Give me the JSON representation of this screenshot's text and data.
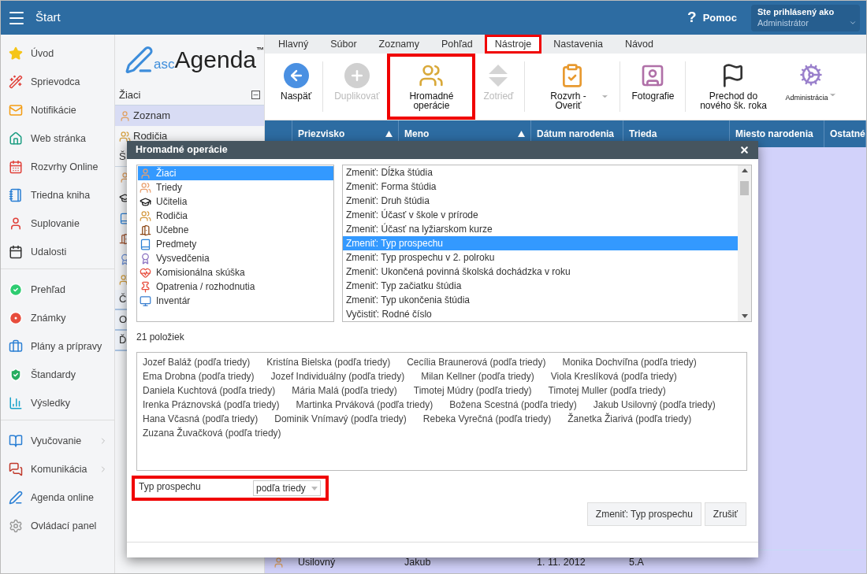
{
  "top_bar": {
    "title": "Štart",
    "help_mark": "?",
    "help_label": "Pomoc",
    "user": {
      "caption": "Ste prihlásený ako",
      "name": "Administrátor"
    }
  },
  "sidebar": {
    "groups": [
      {
        "items": [
          {
            "label": "Úvod",
            "expandable": false
          },
          {
            "label": "Sprievodca",
            "expandable": false
          },
          {
            "label": "Notifikácie",
            "expandable": false
          },
          {
            "label": "Web stránka",
            "expandable": false
          },
          {
            "label": "Rozvrhy Online",
            "expandable": false
          },
          {
            "label": "Triedna kniha",
            "expandable": false
          },
          {
            "label": "Suplovanie",
            "expandable": false
          },
          {
            "label": "Udalosti",
            "expandable": false
          }
        ]
      },
      {
        "items": [
          {
            "label": "Prehľad",
            "expandable": false
          },
          {
            "label": "Známky",
            "expandable": false
          },
          {
            "label": "Plány a prípravy",
            "expandable": false
          },
          {
            "label": "Štandardy",
            "expandable": false
          },
          {
            "label": "Výsledky",
            "expandable": false
          }
        ]
      },
      {
        "items": [
          {
            "label": "Vyučovanie",
            "expandable": true
          },
          {
            "label": "Komunikácia",
            "expandable": true
          },
          {
            "label": "Agenda online",
            "expandable": false
          },
          {
            "label": "Ovládací panel",
            "expandable": false
          }
        ]
      }
    ]
  },
  "logo": {
    "prefix": "asc",
    "name": "Agenda",
    "mark": "™"
  },
  "panel": {
    "sections": [
      {
        "title": "Žiaci",
        "expanded": true,
        "items": [
          {
            "label": "Zoznam",
            "selected": true
          },
          {
            "label": "Rodičia",
            "selected": false
          }
        ]
      },
      {
        "title": "Š",
        "expanded": true,
        "items": [
          {
            "selected": false
          },
          {
            "selected": false
          },
          {
            "selected": false
          },
          {
            "selected": false
          },
          {
            "selected": false
          },
          {
            "selected": false
          }
        ]
      },
      {
        "title": "Č",
        "expanded": false
      },
      {
        "title": "O",
        "expanded": false
      },
      {
        "title": "Ď",
        "expanded": false
      }
    ]
  },
  "ribbon": {
    "tabs": [
      {
        "label": "Hlavný",
        "selected": false,
        "highlighted": false
      },
      {
        "label": "Súbor",
        "selected": false,
        "highlighted": false
      },
      {
        "label": "Zoznamy",
        "selected": false,
        "highlighted": false
      },
      {
        "label": "Pohľad",
        "selected": false,
        "highlighted": false
      },
      {
        "label": "Nástroje",
        "selected": true,
        "highlighted": true
      },
      {
        "label": "Nastavenia",
        "selected": false,
        "highlighted": false
      },
      {
        "label": "Návod",
        "selected": false,
        "highlighted": false
      }
    ],
    "button_groups": [
      {
        "buttons": [
          {
            "label": "Naspäť",
            "disabled": false,
            "dropdown": false,
            "highlighted": false,
            "compact": false
          }
        ]
      },
      {
        "buttons": [
          {
            "label": "Duplikovať",
            "disabled": true,
            "dropdown": false,
            "highlighted": false,
            "compact": false
          },
          {
            "label": "Hromadné operácie",
            "disabled": false,
            "dropdown": false,
            "highlighted": true,
            "compact": false
          },
          {
            "label": "Zotrieď",
            "disabled": true,
            "dropdown": false,
            "highlighted": false,
            "compact": false
          }
        ]
      },
      {
        "buttons": [
          {
            "label": "Rozvrh - Overiť",
            "disabled": false,
            "dropdown": true,
            "highlighted": false,
            "compact": false
          }
        ]
      },
      {
        "buttons": [
          {
            "label": "Fotografie",
            "disabled": false,
            "dropdown": false,
            "highlighted": false,
            "compact": false
          }
        ]
      },
      {
        "buttons": [
          {
            "label": "Prechod do nového šk. roka",
            "disabled": false,
            "dropdown": false,
            "highlighted": false,
            "compact": false
          },
          {
            "label": "Administrácia",
            "disabled": false,
            "dropdown": true,
            "highlighted": false,
            "compact": true
          }
        ]
      }
    ]
  },
  "table": {
    "columns": [
      {
        "label": "Priezvisko",
        "sorted": true
      },
      {
        "label": "Meno",
        "sorted": true
      },
      {
        "label": "Dátum narodenia",
        "sorted": false
      },
      {
        "label": "Trieda",
        "sorted": false
      },
      {
        "label": "Miesto narodenia",
        "sorted": false
      },
      {
        "label": "Ostatné",
        "sorted": false
      }
    ],
    "rows": [
      {
        "cells": [
          "Usilovný",
          "Jakub",
          "1. 11. 2012",
          "5.A"
        ]
      }
    ]
  },
  "dialog": {
    "title": "Hromadné operácie",
    "categories": [
      {
        "label": "Žiaci",
        "selected": true
      },
      {
        "label": "Triedy",
        "selected": false
      },
      {
        "label": "Učitelia",
        "selected": false
      },
      {
        "label": "Rodičia",
        "selected": false
      },
      {
        "label": "Učebne",
        "selected": false
      },
      {
        "label": "Predmety",
        "selected": false
      },
      {
        "label": "Vysvedčenia",
        "selected": false
      },
      {
        "label": "Komisionálna skúška",
        "selected": false
      },
      {
        "label": "Opatrenia / rozhodnutia",
        "selected": false
      },
      {
        "label": "Inventár",
        "selected": false
      }
    ],
    "operations": [
      {
        "label": "Zmeniť: Dĺžka štúdia",
        "selected": false
      },
      {
        "label": "Zmeniť: Forma štúdia",
        "selected": false
      },
      {
        "label": "Zmeniť: Druh štúdia",
        "selected": false
      },
      {
        "label": "Zmeniť: Účasť v škole v prírode",
        "selected": false
      },
      {
        "label": "Zmeniť: Účasť na lyžiarskom kurze",
        "selected": false
      },
      {
        "label": "Zmeniť: Typ prospechu",
        "selected": true
      },
      {
        "label": "Zmeniť: Typ prospechu v 2. polroku",
        "selected": false
      },
      {
        "label": "Zmeniť: Ukončená povinná školská dochádzka v roku",
        "selected": false
      },
      {
        "label": "Zmeniť: Typ začiatku štúdia",
        "selected": false
      },
      {
        "label": "Zmeniť: Typ ukončenia štúdia",
        "selected": false
      },
      {
        "label": "Vyčistiť: Rodné číslo",
        "selected": false
      }
    ],
    "count": "21 položiek",
    "names": [
      "Jozef Baláž (podľa triedy)",
      "Kristína Bielska (podľa triedy)",
      "Cecília Braunerová (podľa triedy)",
      "Monika Dochvíľna (podľa triedy)",
      "Ema Drobna (podľa triedy)",
      "Jozef Individuálny (podľa triedy)",
      "Milan Kellner (podľa triedy)",
      "Viola Kreslíková (podľa triedy)",
      "Daniela Kuchtová (podľa triedy)",
      "Mária Malá (podľa triedy)",
      "Timotej Múdry (podľa triedy)",
      "Timotej Muller (podľa triedy)",
      "Irenka Práznovská (podľa triedy)",
      "Martinka Prváková (podľa triedy)",
      "Božena Scestná (podľa triedy)",
      "Jakub Usilovný (podľa triedy)",
      "Hana Včasná (podľa triedy)",
      "Dominik Vnímavý (podľa triedy)",
      "Rebeka Vyrečná (podľa triedy)",
      "Žanetka Žiarivá (podľa triedy)",
      "Zuzana Žuvačková (podľa triedy)"
    ],
    "field": {
      "label": "Typ prospechu",
      "value": "podľa triedy",
      "highlighted": true
    },
    "buttons": [
      "Zmeniť: Typ prospechu",
      "Zrušiť"
    ]
  }
}
